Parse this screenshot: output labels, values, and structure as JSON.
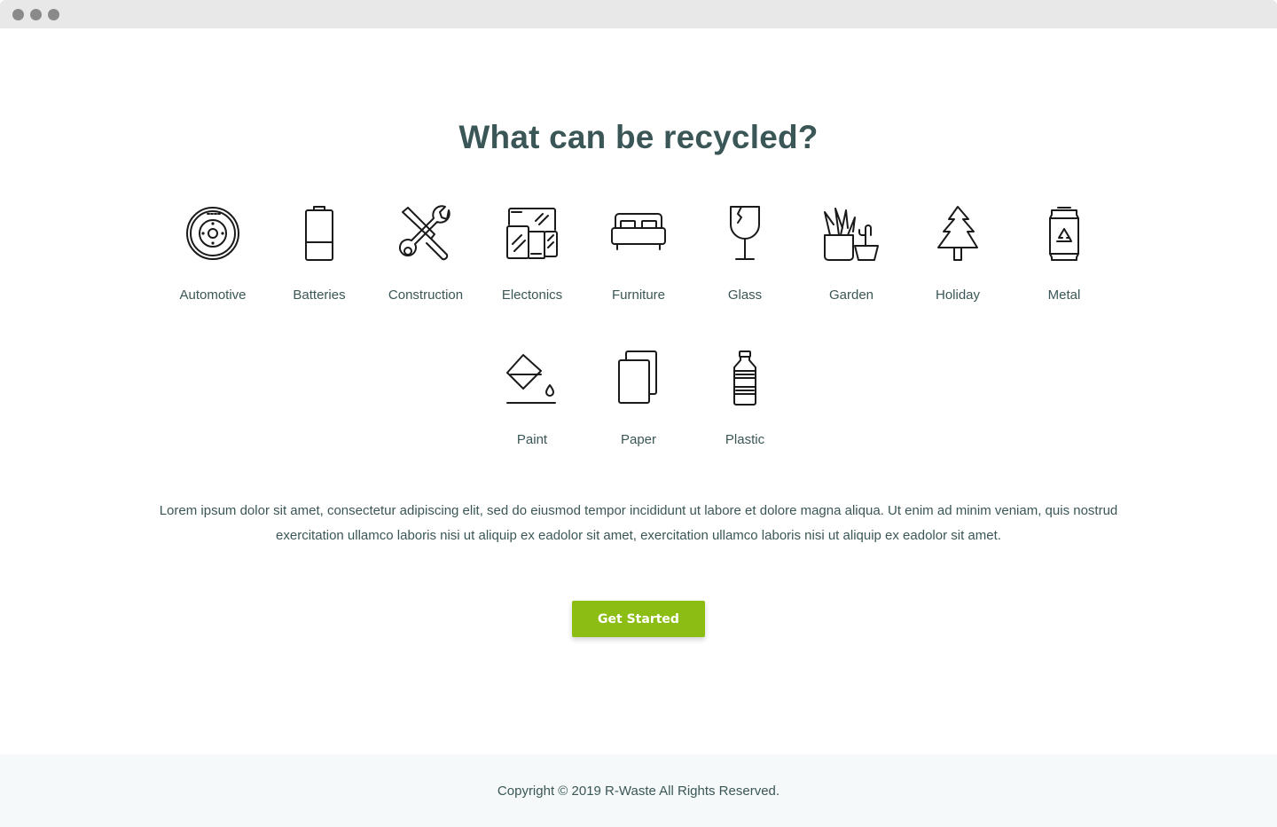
{
  "window": {
    "controls": [
      "close",
      "minimize",
      "maximize"
    ]
  },
  "heading": "What can be recycled?",
  "categories": [
    {
      "label": "Automotive",
      "icon": "tire-icon"
    },
    {
      "label": "Batteries",
      "icon": "battery-icon"
    },
    {
      "label": "Construction",
      "icon": "tools-icon"
    },
    {
      "label": "Electonics",
      "icon": "devices-icon"
    },
    {
      "label": "Furniture",
      "icon": "bed-icon"
    },
    {
      "label": "Glass",
      "icon": "broken-glass-icon"
    },
    {
      "label": "Garden",
      "icon": "plant-pots-icon"
    },
    {
      "label": "Holiday",
      "icon": "pine-tree-icon"
    },
    {
      "label": "Metal",
      "icon": "recycle-can-icon"
    },
    {
      "label": "Paint",
      "icon": "paint-bucket-icon"
    },
    {
      "label": "Paper",
      "icon": "paper-sheets-icon"
    },
    {
      "label": "Plastic",
      "icon": "plastic-bottle-icon"
    }
  ],
  "description": "Lorem ipsum dolor sit amet, consectetur adipiscing elit, sed do eiusmod tempor incididunt ut labore et dolore magna aliqua. Ut enim ad minim veniam, quis nostrud exercitation ullamco laboris nisi ut aliquip ex eadolor sit amet, exercitation ullamco laboris nisi ut aliquip ex eadolor sit amet.",
  "cta": {
    "label": "Get Started"
  },
  "footer": {
    "copyright": "Copyright © 2019 R-Waste All Rights Reserved."
  },
  "colors": {
    "accent": "#8cbd12",
    "text": "#3b5656",
    "footer_bg": "#f5f9fa"
  }
}
